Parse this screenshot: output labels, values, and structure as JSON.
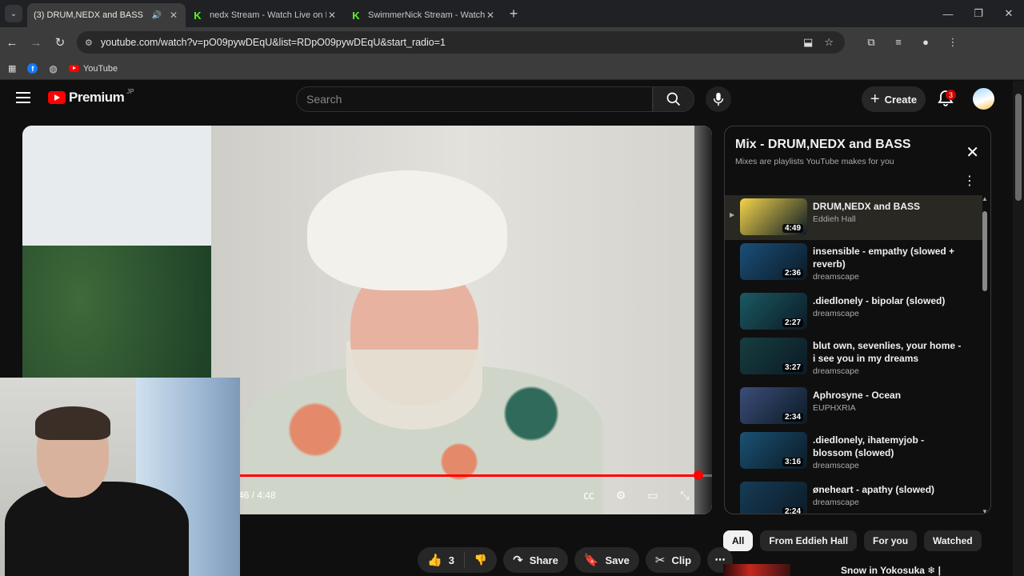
{
  "tabs": [
    {
      "title": "(3) DRUM,NEDX and BASS",
      "favicon": "youtube-icon",
      "active": true
    },
    {
      "title": "nedx Stream - Watch Live on Kick",
      "favicon": "kick-icon",
      "active": false
    },
    {
      "title": "SwimmerNick Stream - Watch Live on Kick",
      "favicon": "kick-icon",
      "active": false
    }
  ],
  "address": {
    "url": "youtube.com/watch?v=pO09pywDEqU&list=RDpO09pywDEqU&start_radio=1"
  },
  "bookmarks": [
    {
      "label": ""
    },
    {
      "label": ""
    },
    {
      "label": "YouTube"
    }
  ],
  "header": {
    "logo": "Premium",
    "region": "JP",
    "search_placeholder": "Search",
    "create_label": "Create",
    "notification_count": "3"
  },
  "player": {
    "time": "46 / 4:48",
    "progress_fraction": 0.98
  },
  "playlist": {
    "title": "Mix - DRUM,NEDX and BASS",
    "subtitle": "Mixes are playlists YouTube makes for you",
    "items": [
      {
        "title": "DRUM,NEDX and BASS",
        "channel": "Eddieh Hall",
        "duration": "4:49",
        "current": true,
        "thumb_color": "#f4d44a"
      },
      {
        "title": "insensible - empathy (slowed + reverb)",
        "channel": "dreamscape",
        "duration": "2:36",
        "current": false,
        "thumb_color": "#1b4f78"
      },
      {
        "title": ".diedlonely - bipolar (slowed)",
        "channel": "dreamscape",
        "duration": "2:27",
        "current": false,
        "thumb_color": "#1a5a62"
      },
      {
        "title": "blut own, sevenlies, your home - i see you in my dreams",
        "channel": "dreamscape",
        "duration": "3:27",
        "current": false,
        "thumb_color": "#163e3e"
      },
      {
        "title": "Aphrosyne - Ocean",
        "channel": "EUPHXRIA",
        "duration": "2:34",
        "current": false,
        "thumb_color": "#3c4d78"
      },
      {
        "title": ".diedlonely, ihatemyjob - blossom (slowed)",
        "channel": "dreamscape",
        "duration": "3:16",
        "current": false,
        "thumb_color": "#1a5273"
      },
      {
        "title": "øneheart - apathy (slowed)",
        "channel": "dreamscape",
        "duration": "2:24",
        "current": false,
        "thumb_color": "#163c56"
      }
    ]
  },
  "chips": [
    "All",
    "From Eddieh Hall",
    "For you",
    "Watched"
  ],
  "actions": {
    "like_count": "3",
    "share": "Share",
    "save": "Save",
    "clip": "Clip"
  },
  "next_up": {
    "title": "Snow in Yokosuka",
    "icon": "❄",
    "sep": "|"
  }
}
